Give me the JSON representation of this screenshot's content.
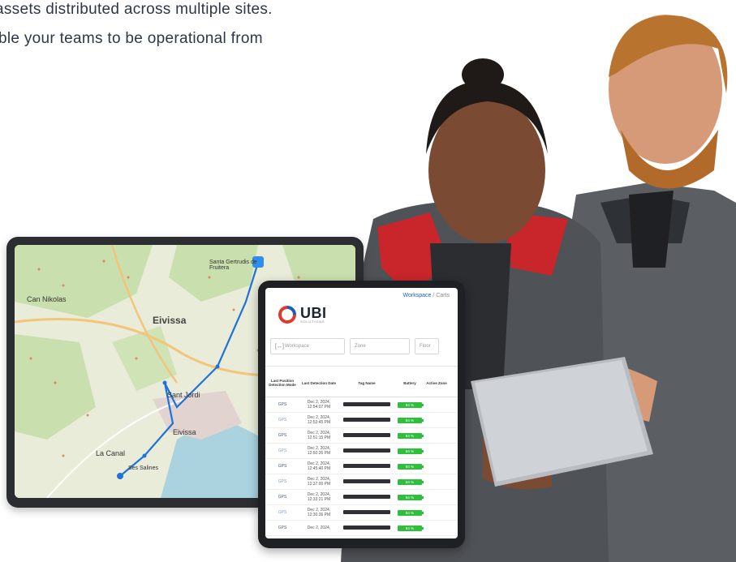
{
  "intro": {
    "line1": "assets distributed across multiple sites.",
    "line2": "ble your teams to be operational from"
  },
  "map": {
    "labels": [
      "Eivissa",
      "Eivissa",
      "Can Nikolas",
      "Sant Jordi",
      "Santa Gertrudis de Fruitera",
      "La Canal",
      "Ses Salines"
    ]
  },
  "dashboard": {
    "breadcrumb": {
      "current": "Workspace",
      "separator": " / ",
      "page": "Carts"
    },
    "logo": {
      "name": "UBI",
      "sub": "SOLUTIONS"
    },
    "filters": {
      "workspace_placeholder": "Workspace",
      "zone_placeholder": "Zone",
      "floor_placeholder": "Floor"
    },
    "columns": [
      "Last Position Detection Mode",
      "Last Detection Date",
      "Tag Name",
      "Battery",
      "Active Zone"
    ],
    "rows": [
      {
        "mode": "GPS",
        "date": "Dec 2, 2024, 12:54:07 PM",
        "battery": "84 %"
      },
      {
        "mode": "GPS",
        "date": "Dec 2, 2024, 12:53:45 PM",
        "battery": "84 %"
      },
      {
        "mode": "GPS",
        "date": "Dec 2, 2024, 12:51:15 PM",
        "battery": "84 %"
      },
      {
        "mode": "GPS",
        "date": "Dec 2, 2024, 12:50:26 PM",
        "battery": "84 %"
      },
      {
        "mode": "GPS",
        "date": "Dec 2, 2024, 12:45:40 PM",
        "battery": "84 %"
      },
      {
        "mode": "GPS",
        "date": "Dec 2, 2024, 12:37:00 PM",
        "battery": "84 %"
      },
      {
        "mode": "GPS",
        "date": "Dec 2, 2024, 12:33:21 PM",
        "battery": "84 %"
      },
      {
        "mode": "GPS",
        "date": "Dec 2, 2024, 12:30:36 PM",
        "battery": "84 %"
      },
      {
        "mode": "GPS",
        "date": "Dec 2, 2024,",
        "battery": "84 %"
      }
    ]
  },
  "colors": {
    "brand_blue": "#1a5fb4",
    "battery_green": "#2fbf3c",
    "track_blue": "#1e73d8",
    "text_dark": "#2d3748"
  }
}
